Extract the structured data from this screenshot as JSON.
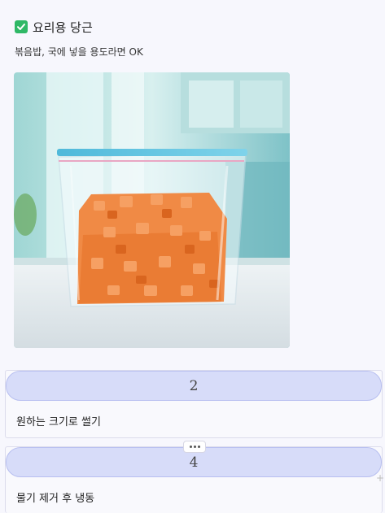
{
  "header": {
    "title": "요리용 당근",
    "icon": "check-icon",
    "subtitle": "볶음밥, 국에 넣을 용도라면 OK"
  },
  "image": {
    "name": "carrot-bag-photo"
  },
  "steps": [
    {
      "number": "2",
      "text": "원하는 크기로 썰기"
    },
    {
      "number": "4",
      "text": "물기 제거 후 냉동"
    }
  ],
  "colors": {
    "accent": "#2fb866",
    "step_pill": "#d7dcf9"
  }
}
